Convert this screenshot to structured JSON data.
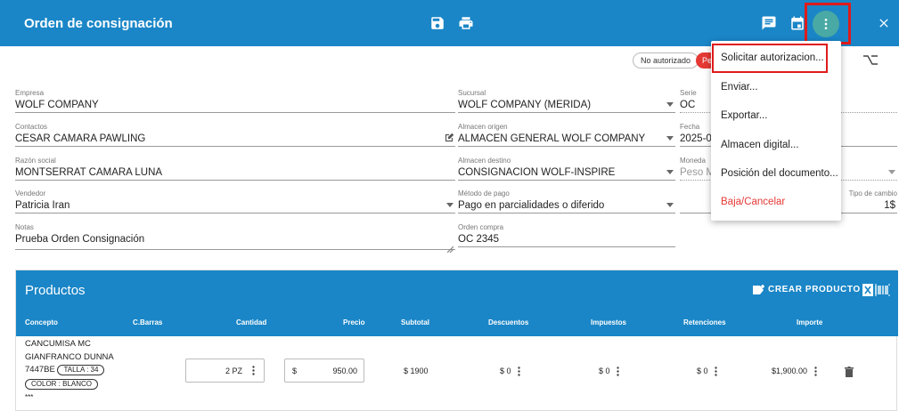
{
  "header": {
    "title": "Orden de consignación",
    "icons": [
      "save-icon",
      "print-icon",
      "comment-icon",
      "calendar-icon",
      "more-vert-icon",
      "close-icon"
    ]
  },
  "status": {
    "chip_no": "No autorizado",
    "chip_red": "Pe"
  },
  "form": {
    "empresa": {
      "label": "Empresa",
      "value": "WOLF COMPANY"
    },
    "contactos": {
      "label": "Contactos",
      "value": "CESAR CAMARA PAWLING"
    },
    "razon": {
      "label": "Razón social",
      "value": "MONTSERRAT CAMARA LUNA"
    },
    "vendedor": {
      "label": "Vendedor",
      "value": "Patricia Iran"
    },
    "notas": {
      "label": "Notas",
      "value": "Prueba Orden Consignación"
    },
    "sucursal": {
      "label": "Sucursal",
      "value": "WOLF COMPANY (MERIDA)"
    },
    "almacen_origen": {
      "label": "Almacen origen",
      "value": "ALMACEN GENERAL WOLF COMPANY"
    },
    "almacen_destino": {
      "label": "Almacen destino",
      "value": "CONSIGNACION WOLF-INSPIRE"
    },
    "metodo_pago": {
      "label": "Método de pago",
      "value": "Pago en parcialidades o diferido"
    },
    "orden_compra": {
      "label": "Orden compra",
      "value": "OC 2345"
    },
    "serie": {
      "label": "Serie",
      "value": "OC"
    },
    "fecha": {
      "label": "Fecha",
      "value": "2025-0"
    },
    "moneda": {
      "label": "Moneda",
      "value": "Peso M"
    },
    "tipo_cambio": {
      "label": "Tipo de cambio",
      "value": "1$"
    }
  },
  "menu": {
    "items": [
      {
        "label": "Solicitar autorizacion..."
      },
      {
        "label": "Enviar..."
      },
      {
        "label": "Exportar..."
      },
      {
        "label": "Almacen digital..."
      },
      {
        "label": "Posición del documento..."
      },
      {
        "label": "Baja/Cancelar"
      }
    ],
    "danger_color": "#e53935"
  },
  "products": {
    "title": "Productos",
    "crear_label": "CREAR PRODUCTO",
    "columns": [
      "Concepto",
      "C.Barras",
      "Cantidad",
      "Precio",
      "Subtotal",
      "Descuentos",
      "Impuestos",
      "Retenciones",
      "Importe"
    ],
    "row": {
      "concept_line1": "CANCUMISA MC",
      "concept_line2": "GIANFRANCO DUNNA",
      "code": "7447BE",
      "talla": "TALLA : 34",
      "color": "COLOR : BLANCO",
      "more": "***",
      "cantidad": "2 PZ",
      "precio_prefix": "$",
      "precio": "950.00",
      "subtotal": "$ 1900",
      "descuentos": "$ 0",
      "impuestos": "$ 0",
      "retenciones": "$ 0",
      "importe": "$1,900.00"
    }
  },
  "colors": {
    "primary": "#1a86c7",
    "accent_circle": "#49a9a4",
    "highlight": "#e01b1b"
  }
}
